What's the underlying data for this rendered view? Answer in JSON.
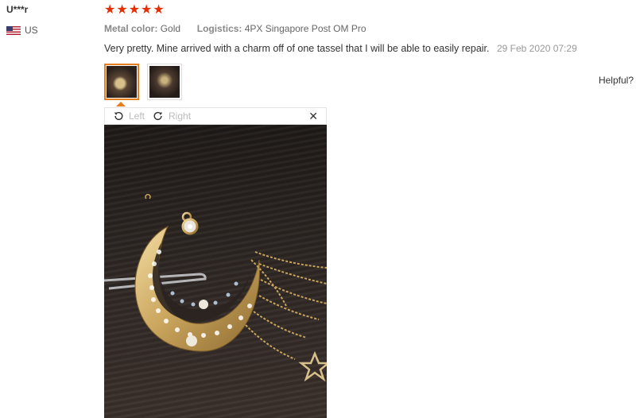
{
  "reviewer": {
    "name": "U***r",
    "country": "US",
    "flag_icon": "us-flag-icon"
  },
  "rating": {
    "stars": 5,
    "max": 5,
    "color": "#e62e04"
  },
  "meta": {
    "metal_color_label": "Metal color:",
    "metal_color_value": "Gold",
    "logistics_label": "Logistics:",
    "logistics_value": "4PX Singapore Post OM Pro"
  },
  "review": {
    "text": "Very pretty. Mine arrived with a charm off of one tassel that I will be able to easily repair.",
    "date": "29 Feb 2020 07:29"
  },
  "helpful_label": "Helpful?",
  "viewer": {
    "rotate_left_label": "Left",
    "rotate_right_label": "Right",
    "close_icon": "close-icon",
    "selected_thumbnail": 1
  },
  "accent_color": "#e67e22"
}
